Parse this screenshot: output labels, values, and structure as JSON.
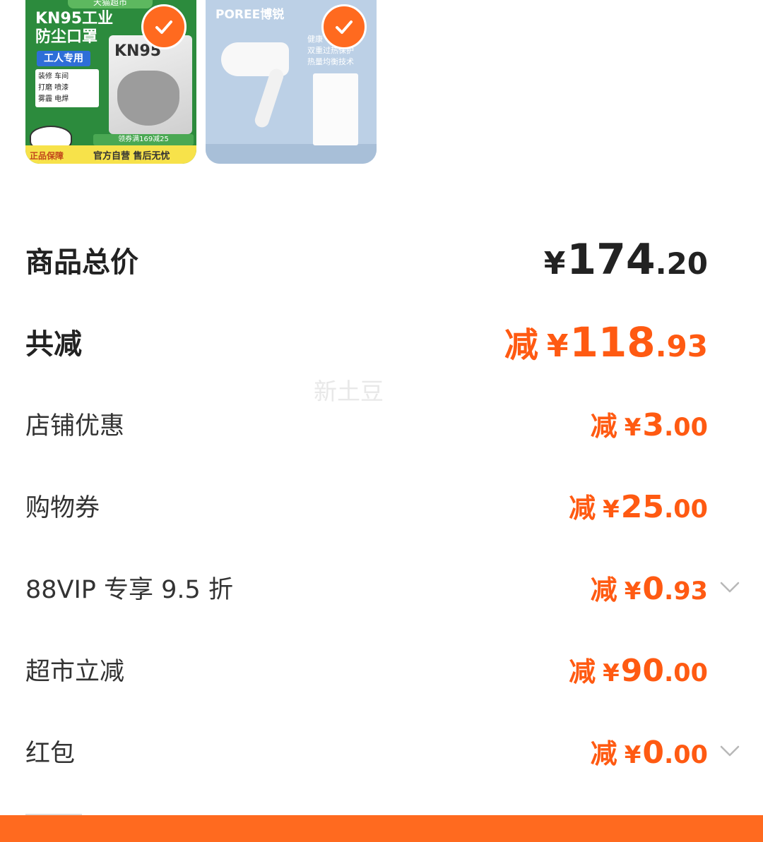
{
  "products": [
    {
      "name": "mask",
      "store": "天猫超市",
      "title_line1": "KN95工业",
      "title_line2": "防尘口罩",
      "tag": "工人专用",
      "features": [
        "装修 车间",
        "打磨 喷漆",
        "雾霾 电焊"
      ],
      "pack_label": "KN95",
      "promo": "领券满169减25",
      "bar_left": "正品保障",
      "bar_right": "官方自营 售后无忧",
      "selected": true
    },
    {
      "name": "hair-dryer",
      "brand": "POREE博锐",
      "text_line1": "健康",
      "text_line2": "双重过热保护",
      "text_line3": "热量均衡技术",
      "selected": true
    }
  ],
  "summary": {
    "total": {
      "label": "商品总价",
      "currency": "¥",
      "int": "174",
      "dec": ".20"
    },
    "discount_total": {
      "label": "共减",
      "prefix": "减",
      "currency": "¥",
      "int": "118",
      "dec": ".93"
    },
    "items": [
      {
        "label": "店铺优惠",
        "prefix": "减",
        "currency": "¥",
        "int": "3",
        "dec": ".00",
        "expandable": false
      },
      {
        "label": "购物券",
        "prefix": "减",
        "currency": "¥",
        "int": "25",
        "dec": ".00",
        "expandable": false
      },
      {
        "label": "88VIP 专享 9.5 折",
        "prefix": "减",
        "currency": "¥",
        "int": "0",
        "dec": ".93",
        "expandable": true
      },
      {
        "label": "超市立减",
        "prefix": "减",
        "currency": "¥",
        "int": "90",
        "dec": ".00",
        "expandable": false
      },
      {
        "label": "红包",
        "prefix": "减",
        "currency": "¥",
        "int": "0",
        "dec": ".00",
        "expandable": true
      }
    ]
  },
  "watermark": "新土豆",
  "colors": {
    "accent": "#ff6a1f",
    "discount": "#ff5a12",
    "text": "#222222"
  }
}
